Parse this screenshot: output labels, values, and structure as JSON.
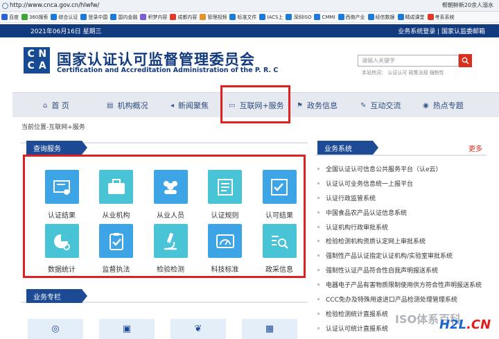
{
  "browser": {
    "url": "http://www.cnca.gov.cn/hlwfw/",
    "news_text": "帮朝鲜新20余人溺水",
    "bookmarks": [
      {
        "label": "百度",
        "color": "#2d62d6"
      },
      {
        "label": "360搜索",
        "color": "#3fa535"
      },
      {
        "label": "综合认证",
        "color": "#1d7ad6"
      },
      {
        "label": "登录中国",
        "color": "#1d7ad6"
      },
      {
        "label": "国内金融",
        "color": "#1d7ad6"
      },
      {
        "label": "积梦内容",
        "color": "#7b5bd6"
      },
      {
        "label": "成都内容",
        "color": "#e23a2a"
      },
      {
        "label": "管理视频",
        "color": "#e2932a"
      },
      {
        "label": "标准文件",
        "color": "#1d7ad6"
      },
      {
        "label": "IACS上",
        "color": "#1d7ad6"
      },
      {
        "label": "深圳ISO",
        "color": "#1d7ad6"
      },
      {
        "label": "CMMI",
        "color": "#1d7ad6"
      },
      {
        "label": "西南产业",
        "color": "#1d7ad6"
      },
      {
        "label": "经信数据",
        "color": "#1d7ad6"
      },
      {
        "label": "精成课堂",
        "color": "#1d7ad6"
      },
      {
        "label": "考系系统",
        "color": "#e23a2a"
      }
    ]
  },
  "topbar": {
    "date": "2021年06月16日 星期三",
    "links": "业务系统登录 | 国家认监委邮箱"
  },
  "header": {
    "logo_letters": [
      "C",
      "N",
      "C",
      "A"
    ],
    "title_cn": "国家认证认可监督管理委员会",
    "title_en": "Certification and Accreditation Administration of the P. R. C",
    "search_placeholder": "请输入关键字",
    "hot_words": "本站热词：  认证认可   政策法规   强制性"
  },
  "nav": [
    {
      "label": "首  页",
      "icon": "home-icon",
      "glyph": "⌂"
    },
    {
      "label": "机构概况",
      "icon": "building-icon",
      "glyph": "▤"
    },
    {
      "label": "新闻聚焦",
      "icon": "megaphone-icon",
      "glyph": "◂"
    },
    {
      "label": "互联网+服务",
      "icon": "monitor-icon",
      "glyph": "▭"
    },
    {
      "label": "政务信息",
      "icon": "flag-icon",
      "glyph": "⚑"
    },
    {
      "label": "互动交流",
      "icon": "edit-icon",
      "glyph": "✎"
    },
    {
      "label": "热点专题",
      "icon": "chat-icon",
      "glyph": "◉"
    }
  ],
  "breadcrumb": "当前位置-互联网+服务",
  "query": {
    "title": "查询服务",
    "tiles": [
      {
        "label": "认证结果",
        "icon": "certificate-icon",
        "color": "#3da4e6"
      },
      {
        "label": "从业机构",
        "icon": "briefcase-icon",
        "color": "#49c3d6"
      },
      {
        "label": "从业人员",
        "icon": "people-icon",
        "color": "#3da4e6"
      },
      {
        "label": "认证规则",
        "icon": "document-icon",
        "color": "#49c3d6"
      },
      {
        "label": "认可结果",
        "icon": "checklist-icon",
        "color": "#3da4e6"
      },
      {
        "label": "数据统计",
        "icon": "piechart-icon",
        "color": "#49c3d6"
      },
      {
        "label": "监督执法",
        "icon": "clipboard-icon",
        "color": "#3da4e6"
      },
      {
        "label": "检验检测",
        "icon": "microscope-icon",
        "color": "#49c3d6"
      },
      {
        "label": "科技标准",
        "icon": "gauge-icon",
        "color": "#3da4e6"
      },
      {
        "label": "政采信息",
        "icon": "search-list-icon",
        "color": "#49c3d6"
      }
    ]
  },
  "business": {
    "title": "业务系统",
    "more": "更多",
    "items": [
      "全国认证认可信息公共服务平台（认e云）",
      "认证认可业务信息统一上报平台",
      "认证行政监管系统",
      "中国食品农产品认证信息系统",
      "认证机构行政审批系统",
      "检验检测机构资质认定网上审批系统",
      "强制性产品认证指定认证机构/实验室审批系统",
      "强制性认证产品符合性自我声明报送系统",
      "电器电子产品有害物质限制使用供方符合性声明报送系统",
      "CCC免办及特殊用途进口产品检测处理管理系统",
      "检验检测统计直报系统",
      "认证认可统计直报系统"
    ]
  },
  "special": {
    "title": "业务专栏",
    "tiles": [
      "ccc-icon",
      "id-card-icon",
      "leaf-icon",
      "building-icon"
    ]
  },
  "watermark": {
    "text": "ISO体系百科",
    "site_a": "H2L",
    "site_b": ".CN"
  }
}
